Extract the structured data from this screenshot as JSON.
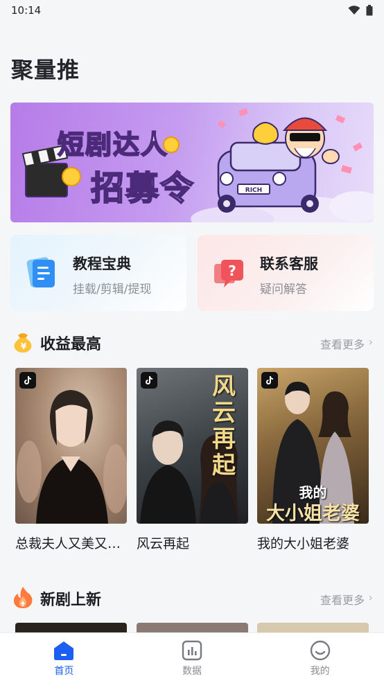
{
  "status_bar": {
    "time": "10:14"
  },
  "app": {
    "title": "聚量推"
  },
  "banner": {
    "line1": "短剧达人",
    "line2": "招募令",
    "plate": "RICH"
  },
  "quick_cards": [
    {
      "title": "教程宝典",
      "subtitle": "挂载/剪辑/提现",
      "icon": "document-icon",
      "color": "#2f8ff5"
    },
    {
      "title": "联系客服",
      "subtitle": "疑问解答",
      "icon": "question-chat-icon",
      "color": "#f0535a"
    }
  ],
  "sections": {
    "top_earnings": {
      "title": "收益最高",
      "more": "查看更多",
      "icon": "money-bag-icon"
    },
    "new_dramas": {
      "title": "新剧上新",
      "more": "查看更多",
      "icon": "flame-icon"
    }
  },
  "dramas": [
    {
      "name": "总裁夫人又美又…",
      "poster_text": ""
    },
    {
      "name": "风云再起",
      "poster_text": "风云再起"
    },
    {
      "name": "我的大小姐老婆",
      "poster_text_small": "我的",
      "poster_text": "大小姐老婆"
    }
  ],
  "tabs": [
    {
      "label": "首页",
      "icon": "home-icon",
      "active": true
    },
    {
      "label": "数据",
      "icon": "chart-icon",
      "active": false
    },
    {
      "label": "我的",
      "icon": "smile-icon",
      "active": false
    }
  ],
  "colors": {
    "accent": "#1b5ef2",
    "banner": "#b67be8"
  }
}
